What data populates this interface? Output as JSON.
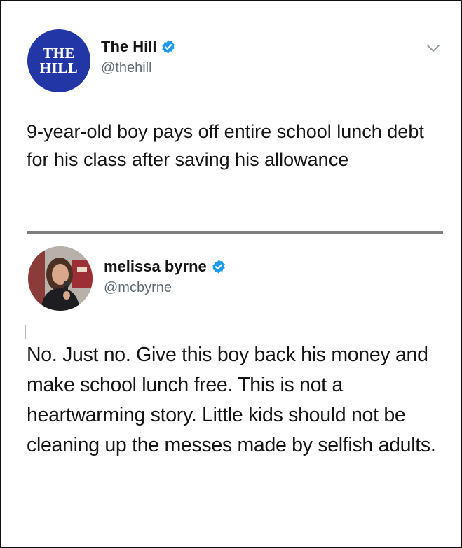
{
  "tweet1": {
    "avatar": {
      "line1": "THE",
      "line2": "HILL",
      "bg": "#2236a6"
    },
    "name": "The Hill",
    "handle": "@thehill",
    "verified": true,
    "menu_icon": "chevron-down-icon",
    "text": "9-year-old boy pays off entire school lunch debt for his class after saving his allowance"
  },
  "tweet2": {
    "name": "melissa byrne",
    "handle": "@mcbyrne",
    "verified": true,
    "avatar_icon": "profile-photo",
    "text": "No. Just no. Give this boy back his money and make school lunch free. This is not a heartwarming story. Little kids should not be cleaning up the messes made by selfish adults."
  },
  "colors": {
    "verified": "#1d9bf0",
    "handle": "#5f6b75",
    "divider": "#7e7e7e"
  }
}
